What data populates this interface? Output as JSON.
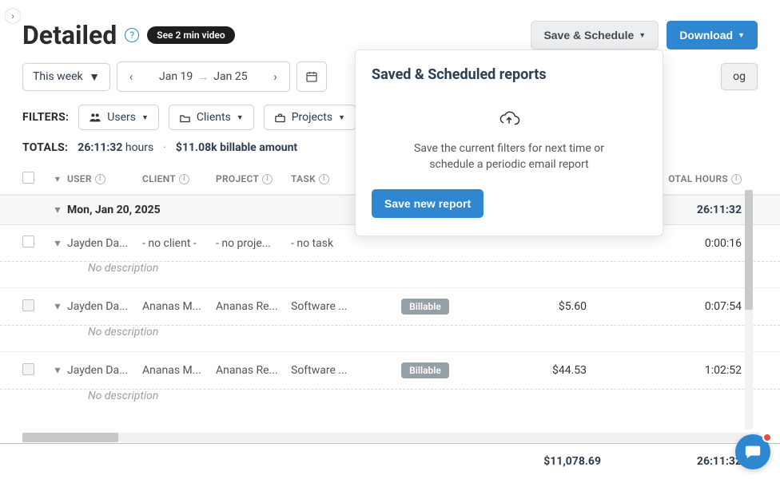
{
  "header": {
    "title": "Detailed",
    "video_label": "See 2 min video",
    "save_schedule_label": "Save & Schedule",
    "download_label": "Download"
  },
  "range": {
    "selected": "This week",
    "date_from": "Jan 19",
    "date_to": "Jan 25"
  },
  "log_button": "og",
  "filters": {
    "label": "FILTERS:",
    "items": [
      "Users",
      "Clients",
      "Projects"
    ]
  },
  "totals": {
    "label": "TOTALS:",
    "hours": "26:11:32",
    "hours_word": "hours",
    "billable": "$11.08k billable amount"
  },
  "columns": {
    "user": "USER",
    "client": "CLIENT",
    "project": "PROJECT",
    "task": "TASK",
    "total_hours": "OTAL HOURS"
  },
  "group": {
    "date": "Mon, Jan 20, 2025",
    "total": "26:11:32"
  },
  "rows": [
    {
      "user": "Jayden Da...",
      "client": "- no client -",
      "project": "- no proje...",
      "task": "- no task",
      "billable": "",
      "amount": "",
      "hours": "0:00:16",
      "description": "No description"
    },
    {
      "user": "Jayden Da...",
      "client": "Ananas M...",
      "project": "Ananas Re...",
      "task": "Software ...",
      "billable": "Billable",
      "amount": "$5.60",
      "hours": "0:07:54",
      "description": "No description"
    },
    {
      "user": "Jayden Da...",
      "client": "Ananas M...",
      "project": "Ananas Re...",
      "task": "Software ...",
      "billable": "Billable",
      "amount": "$44.53",
      "hours": "1:02:52",
      "description": "No description"
    }
  ],
  "footer": {
    "amount": "$11,078.69",
    "hours": "26:11:32"
  },
  "popover": {
    "title": "Saved & Scheduled reports",
    "line1": "Save the current filters for next time or",
    "line2": "schedule a periodic email report",
    "button": "Save new report"
  }
}
